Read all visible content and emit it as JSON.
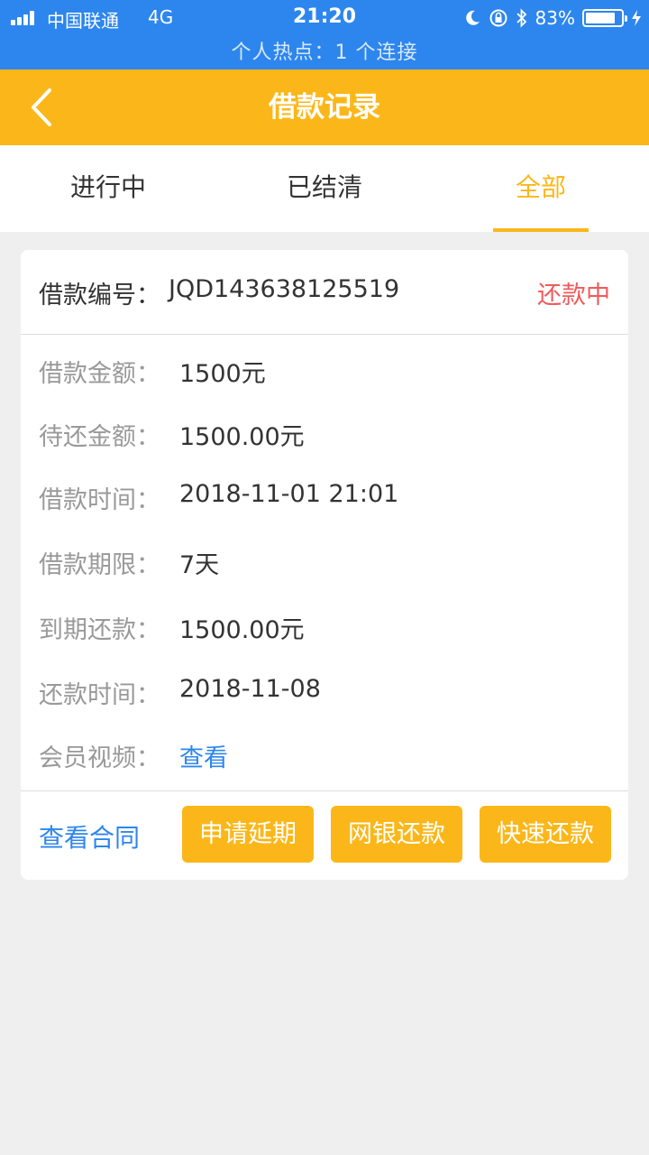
{
  "status_bar": {
    "carrier": "中国联通",
    "network": "4G",
    "time": "21:20",
    "battery": "83%",
    "battery_level": 0.83,
    "hotspot": "个人热点：1 个连接",
    "icons": [
      "signal-icon",
      "moon-icon",
      "rotation-lock-icon",
      "bluetooth-icon",
      "battery-icon",
      "charging-icon"
    ]
  },
  "navbar": {
    "title": "借款记录",
    "back_icon": "chevron-left-icon"
  },
  "tabs": [
    {
      "label": "进行中",
      "active": false
    },
    {
      "label": "已结清",
      "active": false
    },
    {
      "label": "全部",
      "active": true
    }
  ],
  "loan": {
    "number_label": "借款编号：",
    "number": "JQD143638125519",
    "status": "还款中",
    "rows": [
      {
        "key": "借款金额：",
        "value": "1500元"
      },
      {
        "key": "待还金额：",
        "value": "1500.00元"
      },
      {
        "key": "借款时间：",
        "value": "2018-11-01 21:01"
      },
      {
        "key": "借款期限：",
        "value": "7天"
      },
      {
        "key": "到期还款：",
        "value": "1500.00元"
      },
      {
        "key": "还款时间：",
        "value": "2018-11-08"
      },
      {
        "key": "会员视频：",
        "value": "查看"
      }
    ],
    "contract_link": "查看合同",
    "buttons": {
      "extend": "申请延期",
      "bank_repay": "网银还款",
      "quick_repay": "快速还款"
    }
  },
  "colors": {
    "status_bar": "#2d86ee",
    "accent": "#fbb71a",
    "link": "#2d86ee",
    "status_red": "#ef5b5b",
    "background": "#efefef"
  }
}
